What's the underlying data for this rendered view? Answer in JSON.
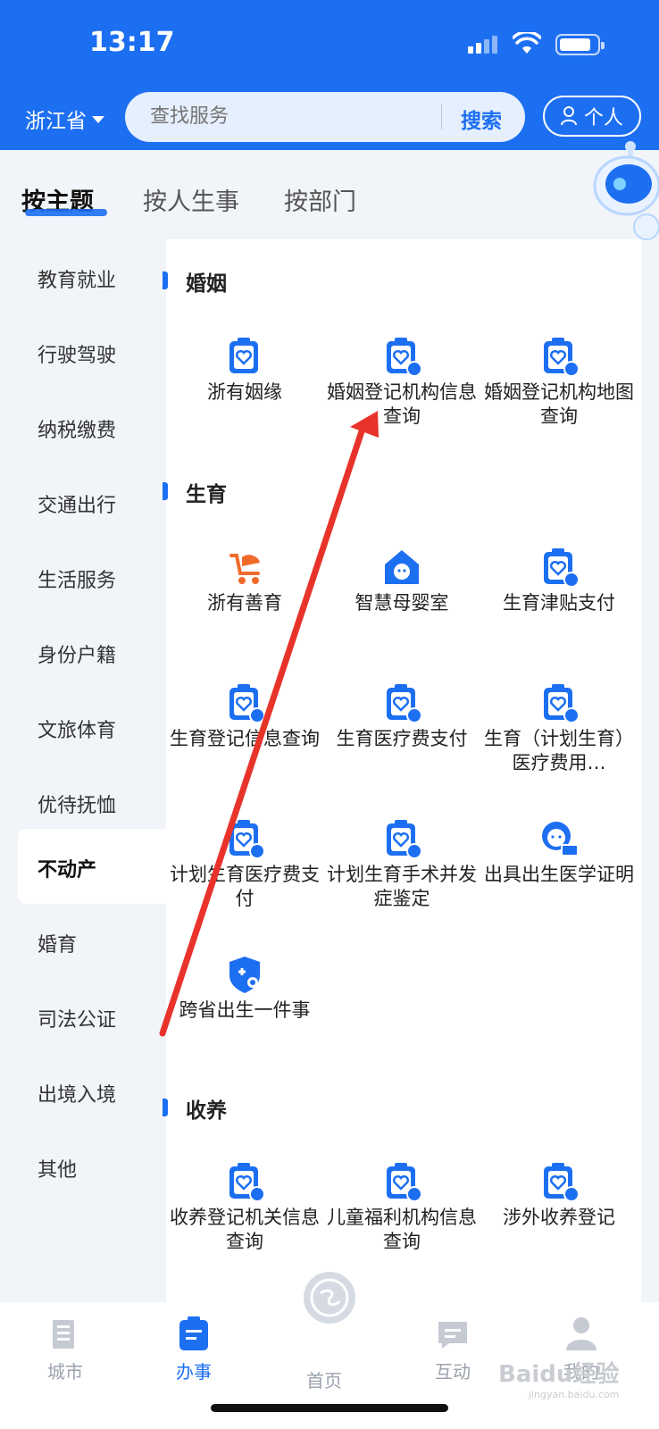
{
  "status_bar": {
    "time": "13:17"
  },
  "header": {
    "region": "浙江省",
    "search": {
      "placeholder": "查找服务",
      "button": "搜索"
    },
    "personal_button": "个人"
  },
  "tabs": [
    {
      "label": "按主题",
      "active": true
    },
    {
      "label": "按人生事",
      "active": false
    },
    {
      "label": "按部门",
      "active": false
    }
  ],
  "sidebar": {
    "items": [
      {
        "label": "教育就业",
        "active": false
      },
      {
        "label": "行驶驾驶",
        "active": false
      },
      {
        "label": "纳税缴费",
        "active": false
      },
      {
        "label": "交通出行",
        "active": false
      },
      {
        "label": "生活服务",
        "active": false
      },
      {
        "label": "身份户籍",
        "active": false
      },
      {
        "label": "文旅体育",
        "active": false
      },
      {
        "label": "优待抚恤",
        "active": false
      },
      {
        "label": "不动产",
        "active": true
      },
      {
        "label": "婚育",
        "active": false
      },
      {
        "label": "司法公证",
        "active": false
      },
      {
        "label": "出境入境",
        "active": false
      },
      {
        "label": "其他",
        "active": false
      }
    ]
  },
  "sections": [
    {
      "title": "婚姻",
      "services": [
        {
          "label": "浙有姻缘",
          "icon": "clipboard-heart-icon"
        },
        {
          "label": "婚姻登记机构信息查询",
          "icon": "clipboard-heart-edit-icon"
        },
        {
          "label": "婚姻登记机构地图查询",
          "icon": "clipboard-heart-edit-icon"
        }
      ]
    },
    {
      "title": "生育",
      "services": [
        {
          "label": "浙有善育",
          "icon": "stroller-icon"
        },
        {
          "label": "智慧母婴室",
          "icon": "house-baby-icon"
        },
        {
          "label": "生育津贴支付",
          "icon": "clipboard-baby-icon"
        },
        {
          "label": "生育登记信息查询",
          "icon": "clipboard-baby-icon"
        },
        {
          "label": "生育医疗费支付",
          "icon": "clipboard-baby-icon"
        },
        {
          "label": "生育（计划生育）医疗费用…",
          "icon": "clipboard-baby-icon"
        },
        {
          "label": "计划生育医疗费支付",
          "icon": "clipboard-baby-icon"
        },
        {
          "label": "计划生育手术并发症鉴定",
          "icon": "clipboard-baby-icon"
        },
        {
          "label": "出具出生医学证明",
          "icon": "baby-card-icon"
        },
        {
          "label": "跨省出生一件事",
          "icon": "shield-baby-icon"
        }
      ]
    },
    {
      "title": "收养",
      "services": [
        {
          "label": "收养登记机关信息查询",
          "icon": "clipboard-heart-hand-icon"
        },
        {
          "label": "儿童福利机构信息查询",
          "icon": "clipboard-heart-hand-icon"
        },
        {
          "label": "涉外收养登记",
          "icon": "clipboard-heart-hand-icon"
        }
      ]
    }
  ],
  "bottom_nav": [
    {
      "label": "城市",
      "icon": "city-icon",
      "active": false
    },
    {
      "label": "办事",
      "icon": "tasks-icon",
      "active": true
    },
    {
      "label": "首页",
      "icon": "home-logo-icon",
      "active": false
    },
    {
      "label": "互动",
      "icon": "chat-icon",
      "active": false
    },
    {
      "label": "我的",
      "icon": "user-icon",
      "active": false
    }
  ],
  "watermark": {
    "brand": "Baidu经验",
    "url": "jingyan.baidu.com"
  },
  "colors": {
    "primary": "#1d6ff2",
    "orange": "#f06b2b",
    "background": "#f1f4f9",
    "annotation_arrow": "#e8332a"
  }
}
